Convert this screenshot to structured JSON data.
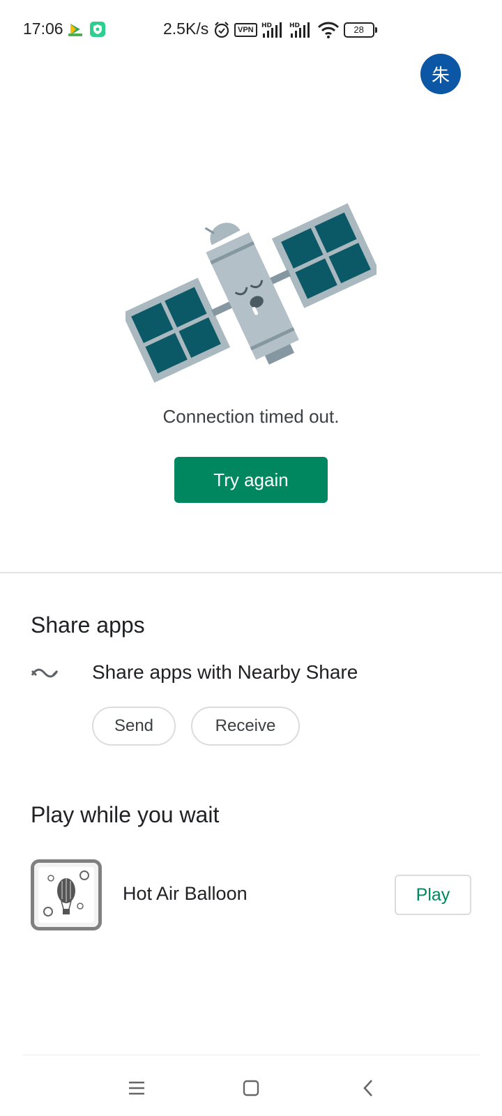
{
  "status_bar": {
    "time": "17:06",
    "net_speed": "2.5K/s",
    "vpn": "VPN",
    "battery": "28",
    "icons": [
      "play-store-icon",
      "shield-icon",
      "alarm-icon",
      "vpn-icon",
      "signal-hd-icon",
      "signal-hd-icon",
      "wifi-icon",
      "battery-icon"
    ]
  },
  "header": {
    "avatar_initial": "朱"
  },
  "error": {
    "message": "Connection timed out.",
    "retry_label": "Try again",
    "illustration": "sleeping-satellite"
  },
  "share": {
    "title": "Share apps",
    "item_label": "Share apps with Nearby Share",
    "icon": "nearby-share-icon",
    "send_label": "Send",
    "receive_label": "Receive"
  },
  "play_section": {
    "title": "Play while you wait",
    "game_name": "Hot Air Balloon",
    "play_label": "Play",
    "game_icon": "hot-air-balloon-icon"
  },
  "nav": {
    "items": [
      "menu-icon",
      "home-icon",
      "back-icon"
    ]
  },
  "colors": {
    "accent": "#01875f",
    "avatar_bg": "#0b57a5",
    "satellite_body": "#aab8bf",
    "satellite_panel": "#0b5866"
  }
}
